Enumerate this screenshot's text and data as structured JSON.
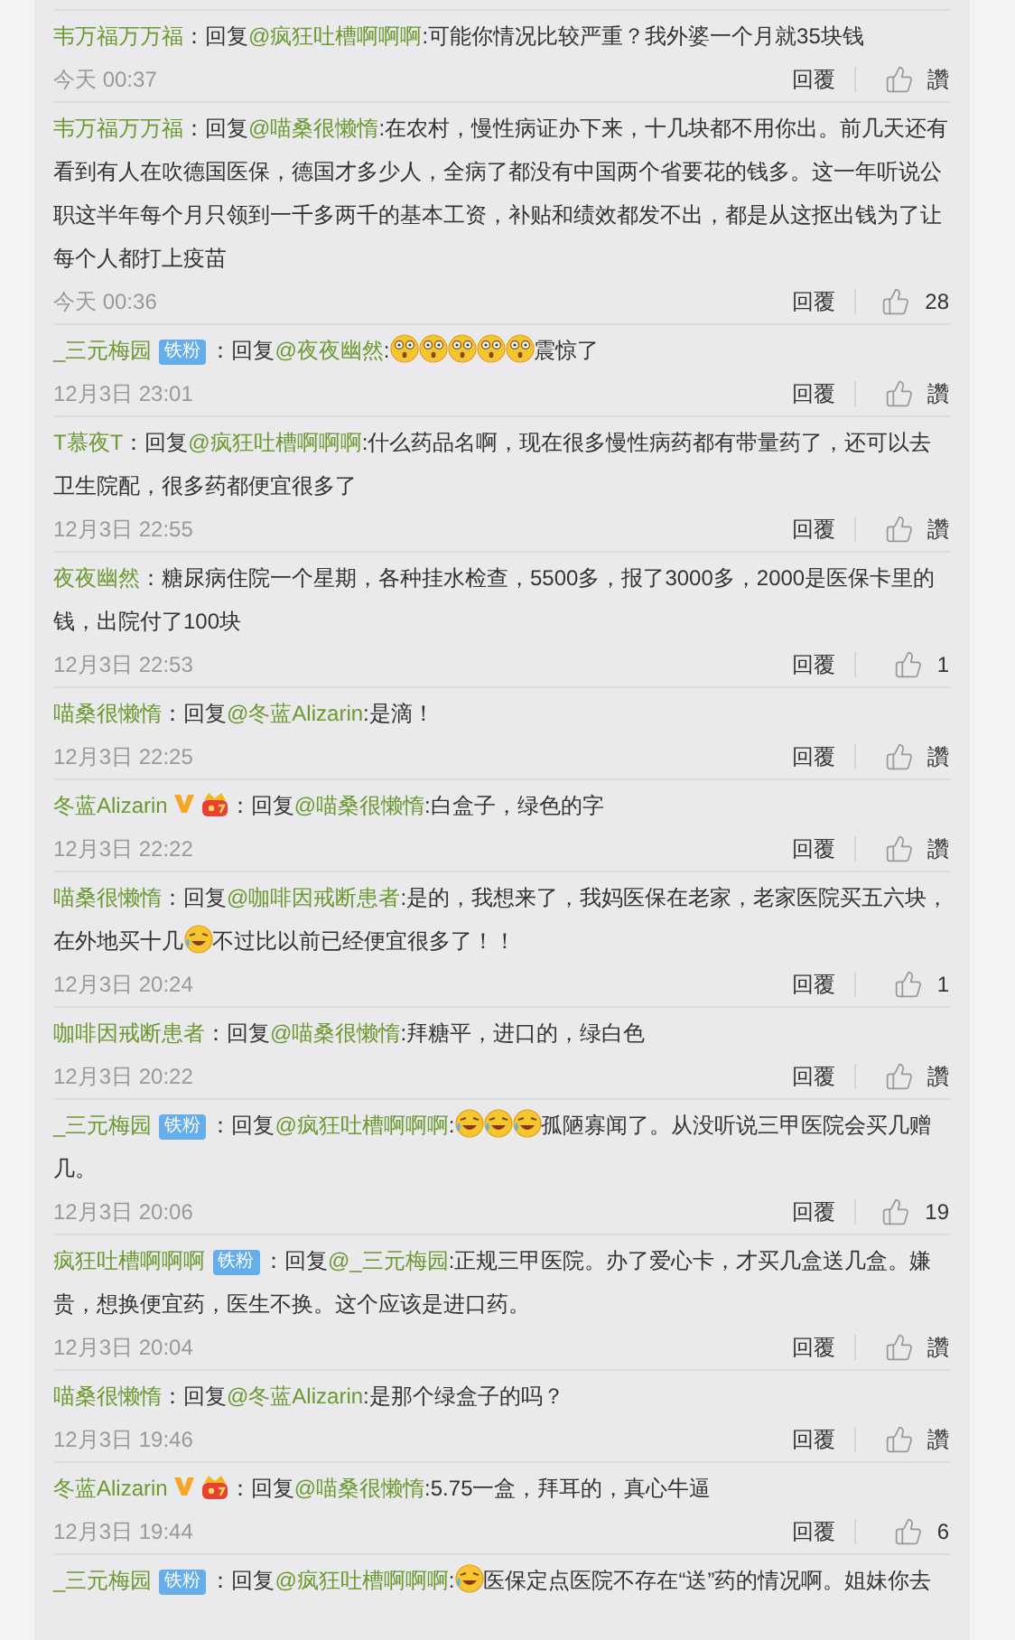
{
  "comments": [
    {
      "user": "韦万福万万福",
      "body": [
        {
          "kind": "text",
          "text": "：回复"
        },
        {
          "kind": "mention",
          "text": "@疯狂吐槽啊啊啊"
        },
        {
          "kind": "text",
          "text": ":可能你情况比较严重？我外婆一个月就35块钱"
        }
      ],
      "time": "今天 00:37",
      "reply": "回覆",
      "likes": "讚"
    },
    {
      "user": "韦万福万万福",
      "body": [
        {
          "kind": "text",
          "text": "：回复"
        },
        {
          "kind": "mention",
          "text": "@喵桑很懒惰"
        },
        {
          "kind": "text",
          "text": ":在农村，慢性病证办下来，十几块都不用你出。前几天还有看到有人在吹德国医保，德国才多少人，全病了都没有中国两个省要花的钱多。这一年听说公职这半年每个月只领到一千多两千的基本工资，补贴和绩效都发不出，都是从这抠出钱为了让每个人都打上疫苗"
        }
      ],
      "time": "今天 00:36",
      "reply": "回覆",
      "likes": "28"
    },
    {
      "user": "_三元梅园",
      "badges": [
        {
          "kind": "fan",
          "label": "铁粉"
        }
      ],
      "body": [
        {
          "kind": "text",
          "text": "：回复"
        },
        {
          "kind": "mention",
          "text": "@夜夜幽然"
        },
        {
          "kind": "text",
          "text": ":"
        },
        {
          "kind": "shocked"
        },
        {
          "kind": "shocked"
        },
        {
          "kind": "shocked"
        },
        {
          "kind": "shocked"
        },
        {
          "kind": "shocked"
        },
        {
          "kind": "text",
          "text": "震惊了"
        }
      ],
      "time": "12月3日 23:01",
      "reply": "回覆",
      "likes": "讚"
    },
    {
      "user": "T慕夜T",
      "body": [
        {
          "kind": "text",
          "text": "：回复"
        },
        {
          "kind": "mention",
          "text": "@疯狂吐槽啊啊啊"
        },
        {
          "kind": "text",
          "text": ":什么药品名啊，现在很多慢性病药都有带量药了，还可以去卫生院配，很多药都便宜很多了"
        }
      ],
      "time": "12月3日 22:55",
      "reply": "回覆",
      "likes": "讚"
    },
    {
      "user": "夜夜幽然",
      "body": [
        {
          "kind": "text",
          "text": "：糖尿病住院一个星期，各种挂水检查，5500多，报了3000多，2000是医保卡里的钱，出院付了100块"
        }
      ],
      "time": "12月3日 22:53",
      "reply": "回覆",
      "likes": "1"
    },
    {
      "user": "喵桑很懒惰",
      "body": [
        {
          "kind": "text",
          "text": "：回复"
        },
        {
          "kind": "mention",
          "text": "@冬蓝Alizarin"
        },
        {
          "kind": "text",
          "text": ":是滴！"
        }
      ],
      "time": "12月3日 22:25",
      "reply": "回覆",
      "likes": "讚"
    },
    {
      "user": "冬蓝Alizarin",
      "badges": [
        {
          "kind": "verified"
        },
        {
          "kind": "crown"
        }
      ],
      "body": [
        {
          "kind": "text",
          "text": "：回复"
        },
        {
          "kind": "mention",
          "text": "@喵桑很懒惰"
        },
        {
          "kind": "text",
          "text": ":白盒子，绿色的字"
        }
      ],
      "time": "12月3日 22:22",
      "reply": "回覆",
      "likes": "讚"
    },
    {
      "user": "喵桑很懒惰",
      "body": [
        {
          "kind": "text",
          "text": "：回复"
        },
        {
          "kind": "mention",
          "text": "@咖啡因戒断患者"
        },
        {
          "kind": "text",
          "text": ":是的，我想来了，我妈医保在老家，老家医院买五六块，在外地买十几"
        },
        {
          "kind": "laugh"
        },
        {
          "kind": "text",
          "text": "不过比以前已经便宜很多了！！"
        }
      ],
      "time": "12月3日 20:24",
      "reply": "回覆",
      "likes": "1"
    },
    {
      "user": "咖啡因戒断患者",
      "body": [
        {
          "kind": "text",
          "text": "：回复"
        },
        {
          "kind": "mention",
          "text": "@喵桑很懒惰"
        },
        {
          "kind": "text",
          "text": ":拜糖平，进口的，绿白色"
        }
      ],
      "time": "12月3日 20:22",
      "reply": "回覆",
      "likes": "讚"
    },
    {
      "user": "_三元梅园",
      "badges": [
        {
          "kind": "fan",
          "label": "铁粉"
        }
      ],
      "body": [
        {
          "kind": "text",
          "text": "：回复"
        },
        {
          "kind": "mention",
          "text": "@疯狂吐槽啊啊啊"
        },
        {
          "kind": "text",
          "text": ":"
        },
        {
          "kind": "laugh"
        },
        {
          "kind": "laugh"
        },
        {
          "kind": "laugh"
        },
        {
          "kind": "text",
          "text": "孤陋寡闻了。从没听说三甲医院会买几赠几。"
        }
      ],
      "time": "12月3日 20:06",
      "reply": "回覆",
      "likes": "19"
    },
    {
      "user": "疯狂吐槽啊啊啊",
      "badges": [
        {
          "kind": "fan",
          "label": "铁粉"
        }
      ],
      "body": [
        {
          "kind": "text",
          "text": "：回复"
        },
        {
          "kind": "mention",
          "text": "@_三元梅园"
        },
        {
          "kind": "text",
          "text": ":正规三甲医院。办了爱心卡，才买几盒送几盒。嫌贵，想换便宜药，医生不换。这个应该是进口药。"
        }
      ],
      "time": "12月3日 20:04",
      "reply": "回覆",
      "likes": "讚"
    },
    {
      "user": "喵桑很懒惰",
      "body": [
        {
          "kind": "text",
          "text": "：回复"
        },
        {
          "kind": "mention",
          "text": "@冬蓝Alizarin"
        },
        {
          "kind": "text",
          "text": ":是那个绿盒子的吗？"
        }
      ],
      "time": "12月3日 19:46",
      "reply": "回覆",
      "likes": "讚"
    },
    {
      "user": "冬蓝Alizarin",
      "badges": [
        {
          "kind": "verified"
        },
        {
          "kind": "crown"
        }
      ],
      "body": [
        {
          "kind": "text",
          "text": "：回复"
        },
        {
          "kind": "mention",
          "text": "@喵桑很懒惰"
        },
        {
          "kind": "text",
          "text": ":5.75一盒，拜耳的，真心牛逼"
        }
      ],
      "time": "12月3日 19:44",
      "reply": "回覆",
      "likes": "6"
    },
    {
      "user": "_三元梅园",
      "badges": [
        {
          "kind": "fan",
          "label": "铁粉"
        }
      ],
      "body": [
        {
          "kind": "text",
          "text": "：回复"
        },
        {
          "kind": "mention",
          "text": "@疯狂吐槽啊啊啊"
        },
        {
          "kind": "text",
          "text": ":"
        },
        {
          "kind": "laugh"
        },
        {
          "kind": "text",
          "text": "医保定点医院不存在“送”药的情况啊。姐妹你去"
        }
      ]
    }
  ]
}
